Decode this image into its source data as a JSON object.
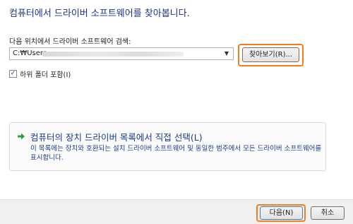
{
  "wizard": {
    "title": "컴퓨터에서 드라이버 소프트웨어를 찾아봅니다."
  },
  "search": {
    "label": "다음 위치에서 드라이버 소프트웨어 검색:",
    "path_value": "C:₩Users",
    "browse_label": "찾아보기(R)...",
    "include_subfolders_label": "하위 폴더 포함(I)",
    "include_subfolders_checked": true
  },
  "pick_from_list": {
    "title": "컴퓨터의 장치 드라이버 목록에서 직접 선택(L)",
    "description": "이 목록에는 장치와 호환되는 설치 드라이버 소프트웨어 및 동일한 범주에서 모든 드라이버 소프트웨어를 표시합니다."
  },
  "footer": {
    "next_label": "다음(N)",
    "cancel_label": "취소"
  },
  "colors": {
    "highlight": "#f27e1f",
    "title_text": "#1e3287",
    "link_text": "#1b3a8c",
    "arrow_green": "#2e9e3e"
  },
  "icons": {
    "dropdown": "chevron-down-icon",
    "command_link": "green-arrow-right-icon",
    "checkbox": "checkmark-icon"
  }
}
